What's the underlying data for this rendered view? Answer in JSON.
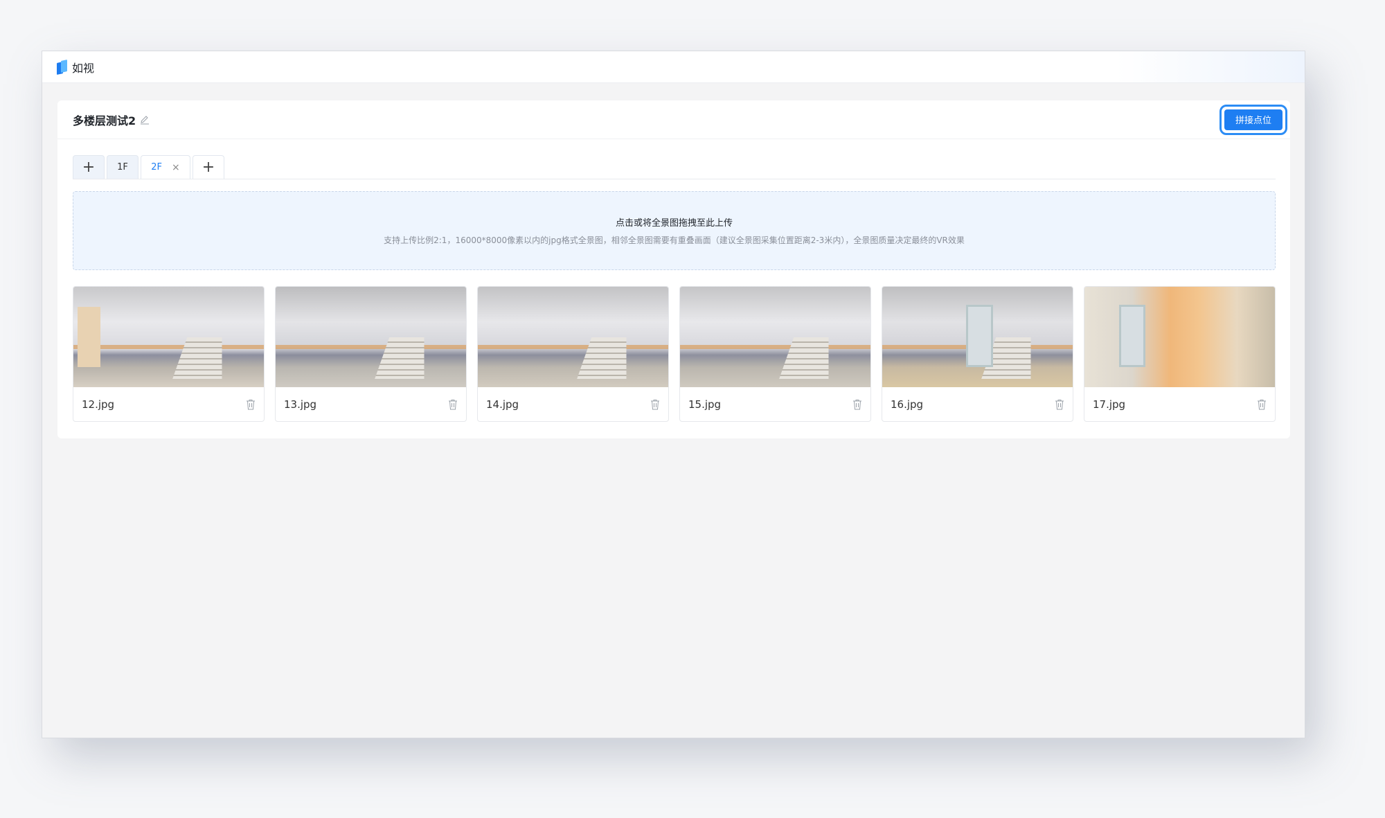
{
  "app": {
    "name": "如视"
  },
  "project": {
    "title": "多楼层测试2",
    "stitch_button": "拼接点位"
  },
  "tabs": [
    {
      "label": "+",
      "type": "add"
    },
    {
      "label": "1F",
      "type": "floor"
    },
    {
      "label": "2F",
      "type": "floor",
      "active": true,
      "close": "×"
    },
    {
      "label": "+",
      "type": "add"
    }
  ],
  "upload": {
    "title": "点击或将全景图拖拽至此上传",
    "hint": "支持上传比例2:1，16000*8000像素以内的jpg格式全景图，相邻全景图需要有重叠画面（建议全景图采集位置距离2-3米内），全景图质量决定最终的VR效果"
  },
  "photos": [
    {
      "name": "12.jpg"
    },
    {
      "name": "13.jpg"
    },
    {
      "name": "14.jpg"
    },
    {
      "name": "15.jpg"
    },
    {
      "name": "16.jpg"
    },
    {
      "name": "17.jpg"
    }
  ],
  "colors": {
    "accent": "#1e7ef2",
    "upload_bg": "#eef5fe"
  },
  "icons": {
    "edit": "edit-icon",
    "trash": "trash-icon",
    "close": "close-icon",
    "plus": "plus-icon"
  }
}
